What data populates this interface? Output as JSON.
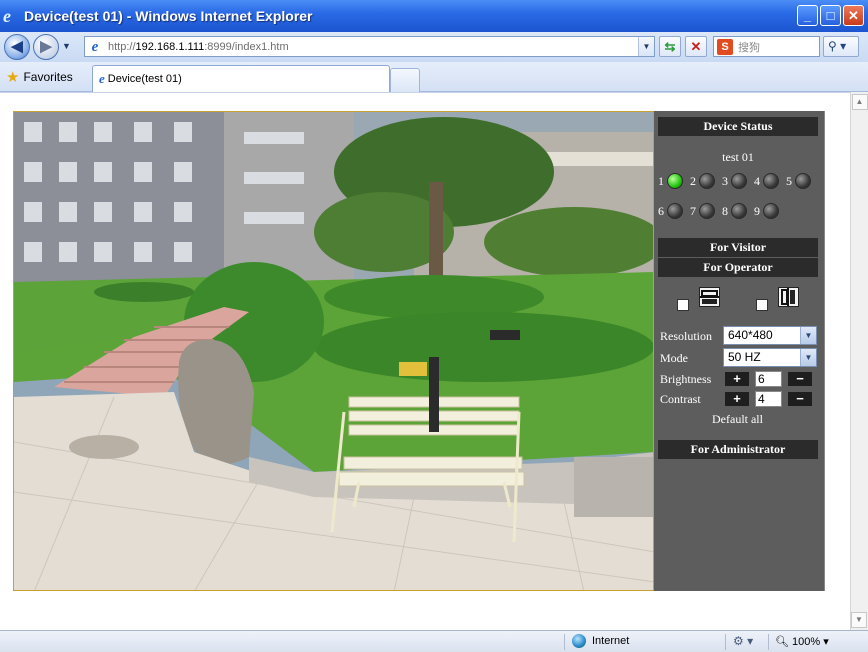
{
  "window": {
    "title": "Device(test 01) - Windows Internet Explorer",
    "controls": [
      "_",
      "□",
      "✕"
    ]
  },
  "address": {
    "url_prefix": "http://",
    "url_host": "192.168.1.111",
    "url_rest": ":8999/index1.htm"
  },
  "search": {
    "placeholder": "搜狗"
  },
  "favorites": {
    "label": "Favorites"
  },
  "tab": {
    "title": "Device(test 01)"
  },
  "panel": {
    "device_status": "Device Status",
    "device_name": "test 01",
    "leds": [
      {
        "num": "1",
        "on": true
      },
      {
        "num": "2",
        "on": false
      },
      {
        "num": "3",
        "on": false
      },
      {
        "num": "4",
        "on": false
      },
      {
        "num": "5",
        "on": false
      },
      {
        "num": "6",
        "on": false
      },
      {
        "num": "7",
        "on": false
      },
      {
        "num": "8",
        "on": false
      },
      {
        "num": "9",
        "on": false
      }
    ],
    "for_visitor": "For Visitor",
    "for_operator": "For Operator",
    "resolution_label": "Resolution",
    "resolution_value": "640*480",
    "mode_label": "Mode",
    "mode_value": "50 HZ",
    "brightness_label": "Brightness",
    "brightness_value": "6",
    "contrast_label": "Contrast",
    "contrast_value": "4",
    "plus": "+",
    "minus": "−",
    "default_all": "Default all",
    "for_administrator": "For Administrator"
  },
  "status": {
    "zone": "Internet",
    "zoom": "100%"
  }
}
